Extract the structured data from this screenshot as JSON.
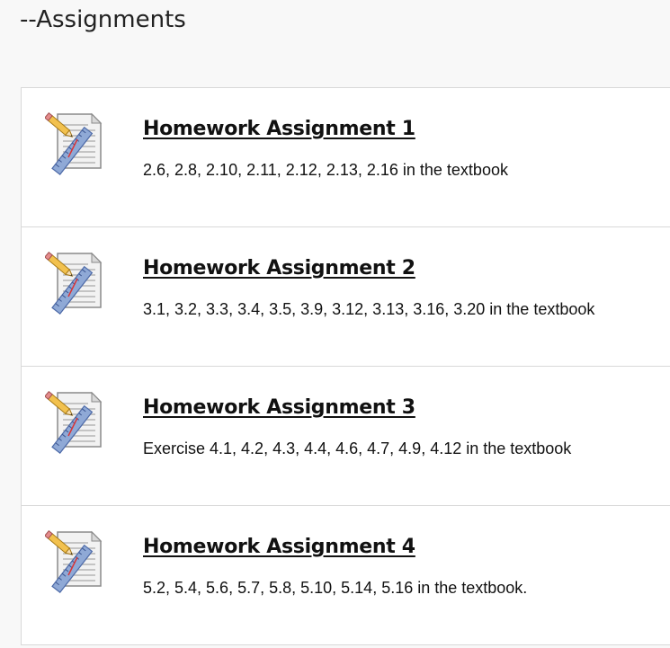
{
  "header": {
    "title": "--Assignments"
  },
  "assignments": [
    {
      "title": "Homework Assignment 1",
      "description": "2.6, 2.8, 2.10, 2.11, 2.12, 2.13, 2.16 in the textbook",
      "icon": "assignment-icon"
    },
    {
      "title": "Homework Assignment 2",
      "description": "3.1, 3.2, 3.3, 3.4, 3.5, 3.9, 3.12, 3.13, 3.16, 3.20 in the textbook",
      "icon": "assignment-icon"
    },
    {
      "title": "Homework Assignment 3",
      "description": "Exercise 4.1, 4.2, 4.3, 4.4, 4.6, 4.7, 4.9, 4.12 in the textbook",
      "icon": "assignment-icon"
    },
    {
      "title": "Homework Assignment 4",
      "description": "5.2, 5.4, 5.6, 5.7, 5.8, 5.10, 5.14, 5.16 in the textbook.",
      "icon": "assignment-icon"
    }
  ]
}
